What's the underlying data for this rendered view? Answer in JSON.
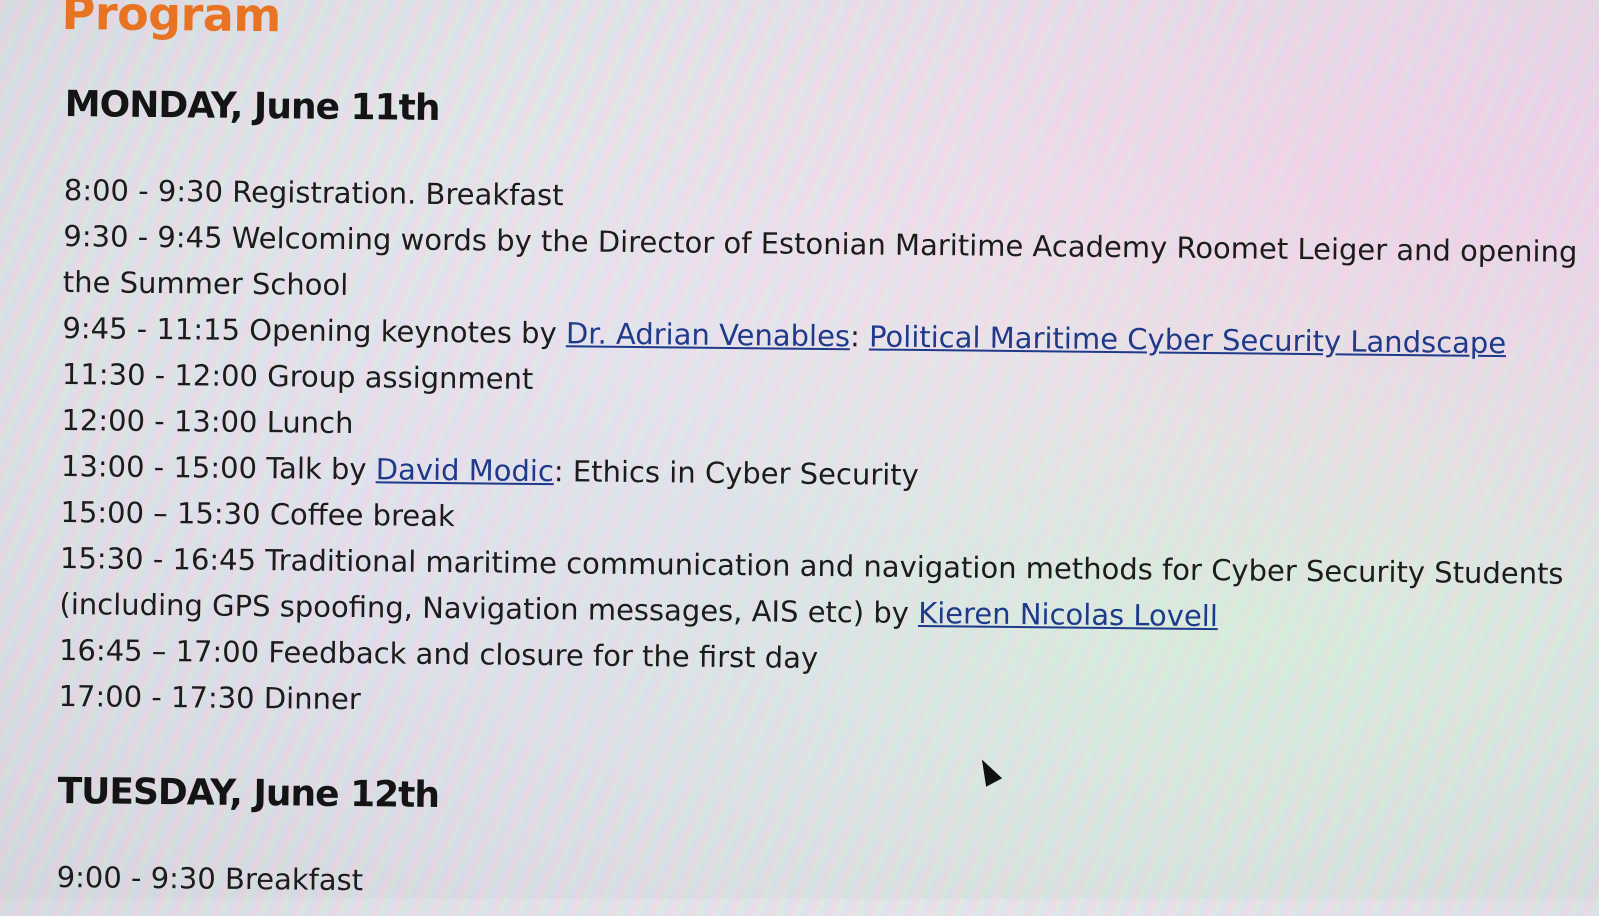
{
  "program": {
    "title": "Program",
    "days": [
      {
        "heading": "MONDAY, June 11th",
        "entries": [
          {
            "time": "8:00 - 9:30",
            "text": "Registration. Breakfast"
          },
          {
            "time": "9:30 - 9:45",
            "text": "Welcoming words by the Director of Estonian Maritime Academy Roomet Leiger and opening the Summer School"
          },
          {
            "time": "9:45 - 11:15",
            "pre": "Opening keynotes by ",
            "link1": "Dr. Adrian Venables",
            "mid": ": ",
            "link2": "Political Maritime Cyber Security Landscape"
          },
          {
            "time": "11:30 - 12:00",
            "text": "Group assignment"
          },
          {
            "time": "12:00 - 13:00",
            "text": "Lunch"
          },
          {
            "time": "13:00 - 15:00",
            "pre": "Talk by ",
            "link1": "David Modic",
            "post": ": Ethics in Cyber Security"
          },
          {
            "time": "15:00 – 15:30",
            "text": "Coffee break"
          },
          {
            "time": "15:30 - 16:45",
            "pre": "Traditional maritime communication and navigation methods for Cyber Security Students (including GPS spoofing, Navigation messages, AIS etc) by ",
            "link1": "Kieren Nicolas Lovell"
          },
          {
            "time": "16:45 – 17:00",
            "text": "Feedback and closure for the first day"
          },
          {
            "time": "17:00 - 17:30",
            "text": "Dinner"
          }
        ]
      },
      {
        "heading": "TUESDAY, June 12th",
        "entries": [
          {
            "time": "9:00 - 9:30",
            "text": "Breakfast"
          }
        ]
      }
    ]
  }
}
